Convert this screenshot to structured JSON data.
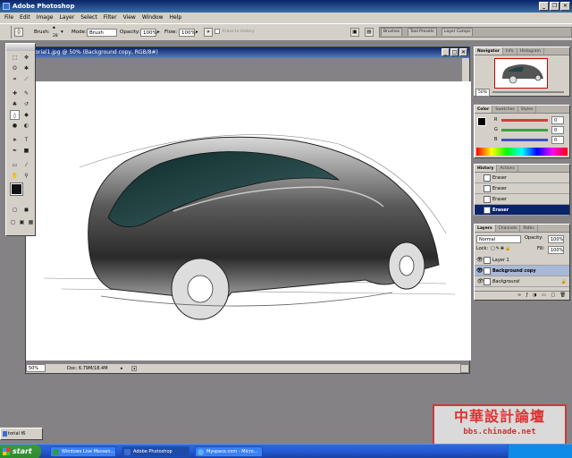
{
  "window": {
    "title": "Adobe Photoshop"
  },
  "menu": [
    "File",
    "Edit",
    "Image",
    "Layer",
    "Select",
    "Filter",
    "View",
    "Window",
    "Help"
  ],
  "options": {
    "brush_label": "Brush:",
    "brush_size": "28",
    "mode_label": "Mode:",
    "mode_value": "Brush",
    "opacity_label": "Opacity:",
    "opacity_value": "100%",
    "flow_label": "Flow:",
    "flow_value": "100%",
    "erase_history": "Erase to History"
  },
  "palette_well_tabs": [
    "Brushes",
    "Tool Presets",
    "Layer Comps"
  ],
  "document": {
    "title": "torial1.jpg @ 50% (Background copy, RGB/8#)",
    "zoom": "50%",
    "doc_info": "Doc: 6.79M/18.4M"
  },
  "navigator": {
    "tabs": [
      "Navigator",
      "Info",
      "Histogram"
    ],
    "zoom": "50%"
  },
  "color": {
    "tabs": [
      "Color",
      "Swatches",
      "Styles"
    ],
    "channels": [
      {
        "label": "R",
        "value": "0",
        "color": "#d04040"
      },
      {
        "label": "G",
        "value": "0",
        "color": "#40a040"
      },
      {
        "label": "B",
        "value": "0",
        "color": "#4050c0"
      }
    ]
  },
  "history": {
    "tabs": [
      "History",
      "Actions"
    ],
    "items": [
      "Eraser",
      "Eraser",
      "Eraser",
      "Eraser"
    ]
  },
  "layers": {
    "tabs": [
      "Layers",
      "Channels",
      "Paths"
    ],
    "blend_mode": "Normal",
    "opacity_label": "Opacity:",
    "opacity": "100%",
    "lock_label": "Lock:",
    "fill_label": "Fill:",
    "fill": "100%",
    "items": [
      "Layer 1",
      "Background copy",
      "Background"
    ]
  },
  "taskbar": {
    "start": "start",
    "buttons": [
      "Windows Live Messen...",
      "Adobe Photoshop",
      "Myspace.com - Micro..."
    ]
  },
  "minimized_window": "torial f6",
  "watermark": {
    "title": "中華設計論壇",
    "url": "bbs.chinade.net"
  }
}
